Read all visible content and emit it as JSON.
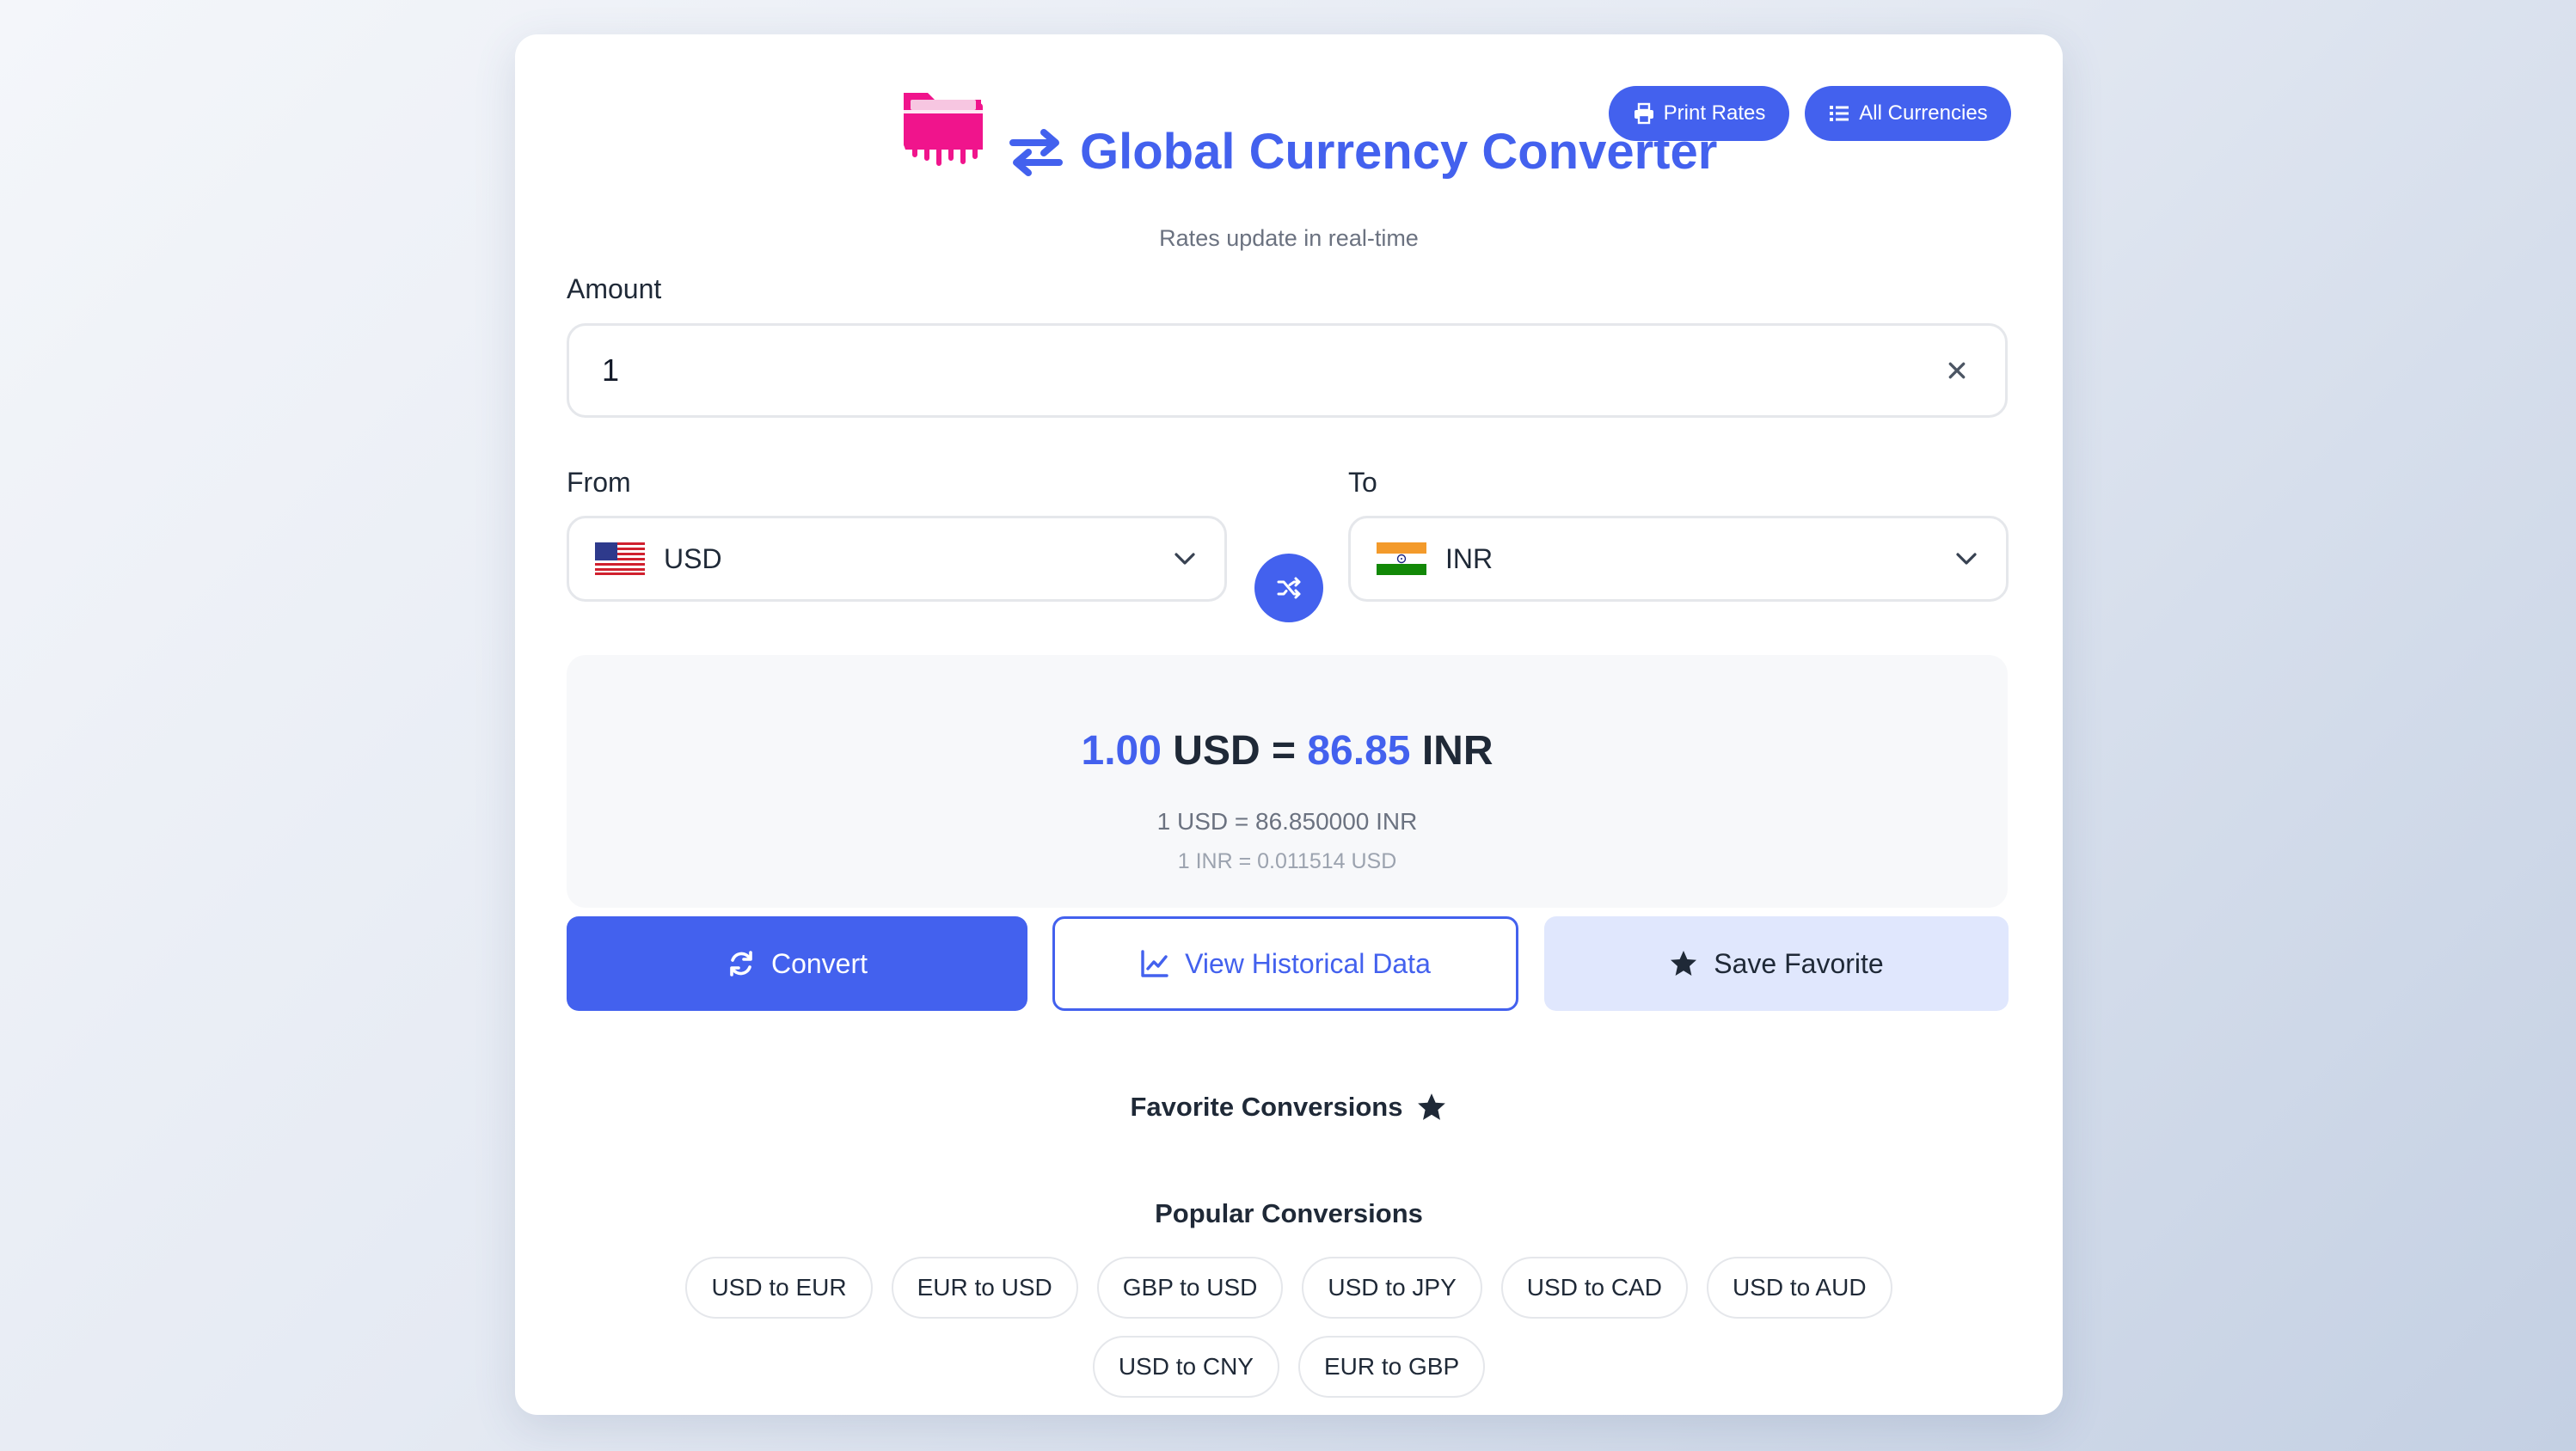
{
  "header": {
    "title": "Global Currency Converter",
    "subtitle": "Rates update in real-time",
    "print_label": "Print Rates",
    "all_currencies_label": "All Currencies"
  },
  "amount": {
    "label": "Amount",
    "value": "1"
  },
  "from": {
    "label": "From",
    "code": "USD",
    "flag": "us-flag-icon"
  },
  "to": {
    "label": "To",
    "code": "INR",
    "flag": "in-flag-icon"
  },
  "result": {
    "from_amount": "1.00",
    "from_code": "USD",
    "equals": "=",
    "to_amount": "86.85",
    "to_code": "INR",
    "rate_line1": "1 USD = 86.850000 INR",
    "rate_line2": "1 INR = 0.011514 USD"
  },
  "actions": {
    "convert": "Convert",
    "history": "View Historical Data",
    "save": "Save Favorite"
  },
  "favorites": {
    "heading": "Favorite Conversions"
  },
  "popular": {
    "heading": "Popular Conversions",
    "items": [
      "USD to EUR",
      "EUR to USD",
      "GBP to USD",
      "USD to JPY",
      "USD to CAD",
      "USD to AUD",
      "USD to CNY",
      "EUR to GBP"
    ]
  },
  "colors": {
    "accent": "#4361ee",
    "brand_icon": "#f0148c",
    "result_bg": "#f7f8fa",
    "save_bg": "#e0e7fd"
  }
}
